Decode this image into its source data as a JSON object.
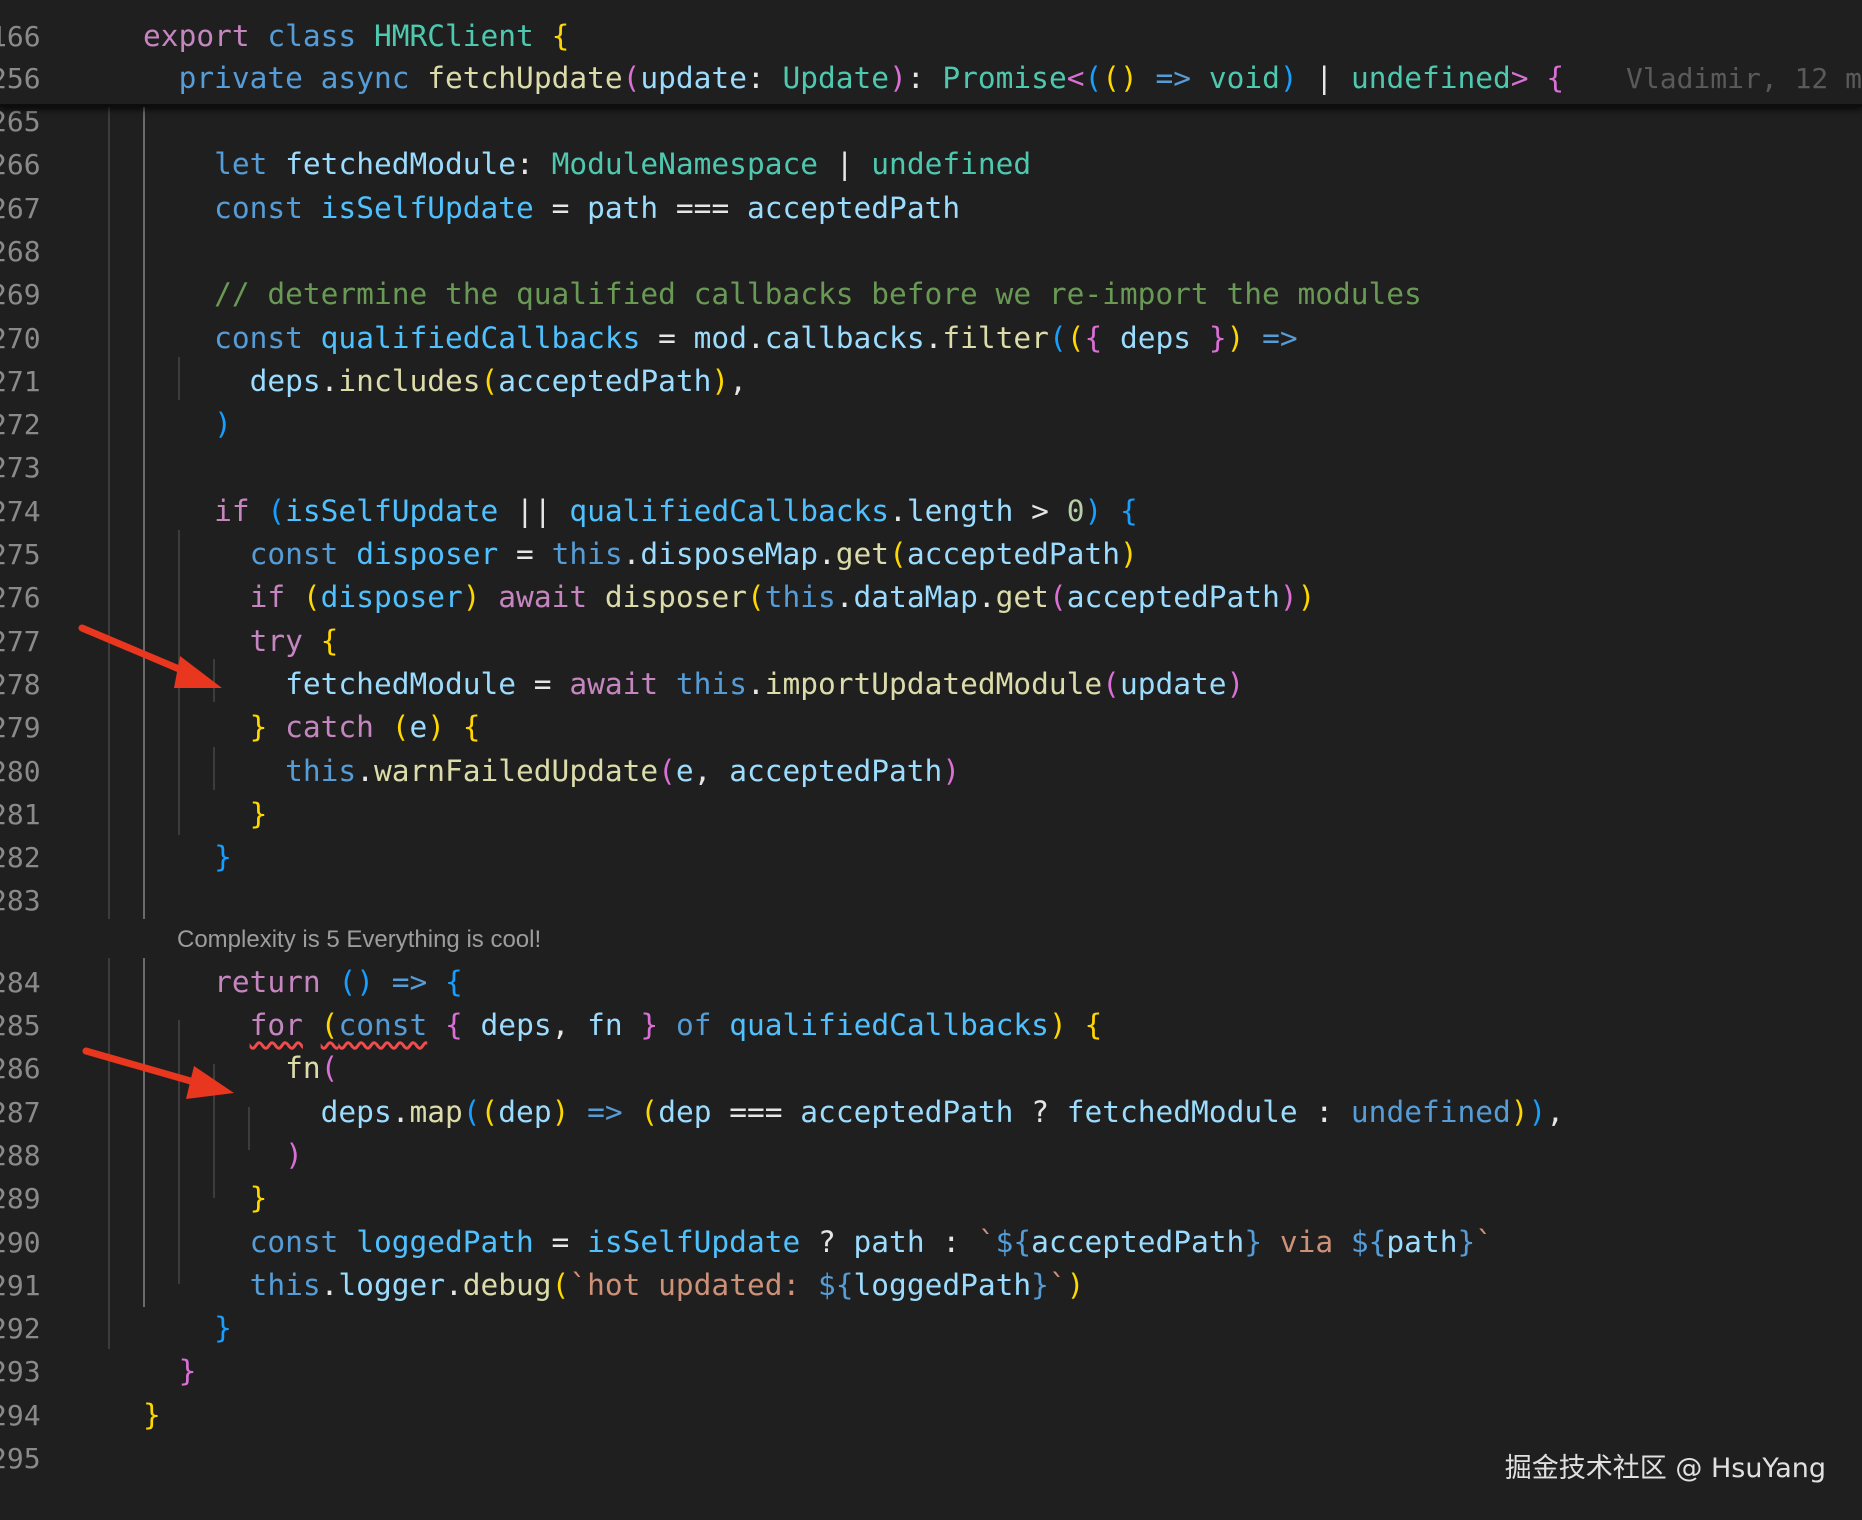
{
  "editor": {
    "sticky": [
      {
        "ln": "166",
        "tokens": [
          [
            "    ",
            ""
          ],
          [
            "export",
            "k-purple"
          ],
          [
            " ",
            ""
          ],
          [
            "class",
            "k-blue"
          ],
          [
            " ",
            ""
          ],
          [
            "HMRClient",
            "k-teal"
          ],
          [
            " ",
            ""
          ],
          [
            "{",
            "b1"
          ]
        ]
      },
      {
        "ln": "256",
        "tokens": [
          [
            "      ",
            ""
          ],
          [
            "private",
            "k-blue"
          ],
          [
            " ",
            ""
          ],
          [
            "async",
            "k-blue"
          ],
          [
            " ",
            ""
          ],
          [
            "fetchUpdate",
            "k-yellow"
          ],
          [
            "(",
            "b2"
          ],
          [
            "update",
            "k-var"
          ],
          [
            ": ",
            "k-white"
          ],
          [
            "Update",
            "k-teal"
          ],
          [
            ")",
            "b2"
          ],
          [
            ": ",
            "k-white"
          ],
          [
            "Promise",
            "k-teal"
          ],
          [
            "<",
            "b2"
          ],
          [
            "(",
            "b3"
          ],
          [
            "()",
            "b1"
          ],
          [
            " ",
            ""
          ],
          [
            "=>",
            "k-blue"
          ],
          [
            " ",
            ""
          ],
          [
            "void",
            "k-teal"
          ],
          [
            ")",
            "b3"
          ],
          [
            " | ",
            "k-white"
          ],
          [
            "undefined",
            "k-teal"
          ],
          [
            ">",
            "b2"
          ],
          [
            " ",
            ""
          ],
          [
            "{",
            "b2"
          ]
        ]
      }
    ],
    "blame": "Vladimir, 12 m",
    "lines": [
      {
        "ln": "265",
        "tokens": []
      },
      {
        "ln": "266",
        "tokens": [
          [
            "        ",
            ""
          ],
          [
            "let",
            "k-blue"
          ],
          [
            " ",
            ""
          ],
          [
            "fetchedModule",
            "k-var"
          ],
          [
            ": ",
            "k-white"
          ],
          [
            "ModuleNamespace",
            "k-teal"
          ],
          [
            " | ",
            "k-white"
          ],
          [
            "undefined",
            "k-teal"
          ]
        ]
      },
      {
        "ln": "267",
        "tokens": [
          [
            "        ",
            ""
          ],
          [
            "const",
            "k-blue"
          ],
          [
            " ",
            ""
          ],
          [
            "isSelfUpdate",
            "k-const"
          ],
          [
            " = ",
            "k-white"
          ],
          [
            "path",
            "k-var"
          ],
          [
            " === ",
            "k-white"
          ],
          [
            "acceptedPath",
            "k-var"
          ]
        ]
      },
      {
        "ln": "268",
        "tokens": []
      },
      {
        "ln": "269",
        "tokens": [
          [
            "        ",
            ""
          ],
          [
            "// determine the qualified callbacks before we re-import the modules",
            "k-comment"
          ]
        ]
      },
      {
        "ln": "270",
        "tokens": [
          [
            "        ",
            ""
          ],
          [
            "const",
            "k-blue"
          ],
          [
            " ",
            ""
          ],
          [
            "qualifiedCallbacks",
            "k-const"
          ],
          [
            " = ",
            "k-white"
          ],
          [
            "mod",
            "k-var"
          ],
          [
            ".",
            "k-white"
          ],
          [
            "callbacks",
            "k-var"
          ],
          [
            ".",
            "k-white"
          ],
          [
            "filter",
            "k-yellow"
          ],
          [
            "(",
            "b3"
          ],
          [
            "(",
            "b1"
          ],
          [
            "{",
            "b2"
          ],
          [
            " ",
            ""
          ],
          [
            "deps",
            "k-var"
          ],
          [
            " ",
            ""
          ],
          [
            "}",
            "b2"
          ],
          [
            ")",
            "b1"
          ],
          [
            " ",
            ""
          ],
          [
            "=>",
            "k-blue"
          ]
        ]
      },
      {
        "ln": "271",
        "tokens": [
          [
            "          ",
            ""
          ],
          [
            "deps",
            "k-var"
          ],
          [
            ".",
            "k-white"
          ],
          [
            "includes",
            "k-yellow"
          ],
          [
            "(",
            "b1"
          ],
          [
            "acceptedPath",
            "k-var"
          ],
          [
            ")",
            "b1"
          ],
          [
            ",",
            "k-white"
          ]
        ]
      },
      {
        "ln": "272",
        "tokens": [
          [
            "        ",
            ""
          ],
          [
            ")",
            "b3"
          ]
        ]
      },
      {
        "ln": "273",
        "tokens": []
      },
      {
        "ln": "274",
        "tokens": [
          [
            "        ",
            ""
          ],
          [
            "if",
            "k-purple"
          ],
          [
            " ",
            ""
          ],
          [
            "(",
            "b3"
          ],
          [
            "isSelfUpdate",
            "k-const"
          ],
          [
            " || ",
            "k-white"
          ],
          [
            "qualifiedCallbacks",
            "k-const"
          ],
          [
            ".",
            "k-white"
          ],
          [
            "length",
            "k-var"
          ],
          [
            " > ",
            "k-white"
          ],
          [
            "0",
            "k-num"
          ],
          [
            ")",
            "b3"
          ],
          [
            " ",
            ""
          ],
          [
            "{",
            "b3"
          ]
        ]
      },
      {
        "ln": "275",
        "tokens": [
          [
            "          ",
            ""
          ],
          [
            "const",
            "k-blue"
          ],
          [
            " ",
            ""
          ],
          [
            "disposer",
            "k-const"
          ],
          [
            " = ",
            "k-white"
          ],
          [
            "this",
            "k-blue"
          ],
          [
            ".",
            "k-white"
          ],
          [
            "disposeMap",
            "k-var"
          ],
          [
            ".",
            "k-white"
          ],
          [
            "get",
            "k-yellow"
          ],
          [
            "(",
            "b1"
          ],
          [
            "acceptedPath",
            "k-var"
          ],
          [
            ")",
            "b1"
          ]
        ]
      },
      {
        "ln": "276",
        "tokens": [
          [
            "          ",
            ""
          ],
          [
            "if",
            "k-purple"
          ],
          [
            " ",
            ""
          ],
          [
            "(",
            "b1"
          ],
          [
            "disposer",
            "k-const"
          ],
          [
            ")",
            "b1"
          ],
          [
            " ",
            ""
          ],
          [
            "await",
            "k-purple"
          ],
          [
            " ",
            ""
          ],
          [
            "disposer",
            "k-yellow"
          ],
          [
            "(",
            "b1"
          ],
          [
            "this",
            "k-blue"
          ],
          [
            ".",
            "k-white"
          ],
          [
            "dataMap",
            "k-var"
          ],
          [
            ".",
            "k-white"
          ],
          [
            "get",
            "k-yellow"
          ],
          [
            "(",
            "b2"
          ],
          [
            "acceptedPath",
            "k-var"
          ],
          [
            ")",
            "b2"
          ],
          [
            ")",
            "b1"
          ]
        ]
      },
      {
        "ln": "277",
        "tokens": [
          [
            "          ",
            ""
          ],
          [
            "try",
            "k-purple"
          ],
          [
            " ",
            ""
          ],
          [
            "{",
            "b1"
          ]
        ]
      },
      {
        "ln": "278",
        "tokens": [
          [
            "            ",
            ""
          ],
          [
            "fetchedModule",
            "k-var"
          ],
          [
            " = ",
            "k-white"
          ],
          [
            "await",
            "k-purple"
          ],
          [
            " ",
            ""
          ],
          [
            "this",
            "k-blue"
          ],
          [
            ".",
            "k-white"
          ],
          [
            "importUpdatedModule",
            "k-yellow"
          ],
          [
            "(",
            "b2"
          ],
          [
            "update",
            "k-var"
          ],
          [
            ")",
            "b2"
          ]
        ]
      },
      {
        "ln": "279",
        "tokens": [
          [
            "          ",
            ""
          ],
          [
            "}",
            "b1"
          ],
          [
            " ",
            ""
          ],
          [
            "catch",
            "k-purple"
          ],
          [
            " ",
            ""
          ],
          [
            "(",
            "b1"
          ],
          [
            "e",
            "k-var"
          ],
          [
            ")",
            "b1"
          ],
          [
            " ",
            ""
          ],
          [
            "{",
            "b1"
          ]
        ]
      },
      {
        "ln": "280",
        "tokens": [
          [
            "            ",
            ""
          ],
          [
            "this",
            "k-blue"
          ],
          [
            ".",
            "k-white"
          ],
          [
            "warnFailedUpdate",
            "k-yellow"
          ],
          [
            "(",
            "b2"
          ],
          [
            "e",
            "k-var"
          ],
          [
            ", ",
            "k-white"
          ],
          [
            "acceptedPath",
            "k-var"
          ],
          [
            ")",
            "b2"
          ]
        ]
      },
      {
        "ln": "281",
        "tokens": [
          [
            "          ",
            ""
          ],
          [
            "}",
            "b1"
          ]
        ]
      },
      {
        "ln": "282",
        "tokens": [
          [
            "        ",
            ""
          ],
          [
            "}",
            "b3"
          ]
        ]
      },
      {
        "ln": "283",
        "tokens": []
      },
      {
        "ln": "284",
        "tokens": [
          [
            "        ",
            ""
          ],
          [
            "return",
            "k-purple"
          ],
          [
            " ",
            ""
          ],
          [
            "()",
            "b3"
          ],
          [
            " ",
            ""
          ],
          [
            "=>",
            "k-blue"
          ],
          [
            " ",
            ""
          ],
          [
            "{",
            "b3"
          ]
        ]
      },
      {
        "ln": "285",
        "tokens": [
          [
            "          ",
            ""
          ],
          [
            "for",
            "k-purple squiggle"
          ],
          [
            " ",
            ""
          ],
          [
            "(",
            "b1 squiggle"
          ],
          [
            "const",
            "k-blue squiggle"
          ],
          [
            " ",
            ""
          ],
          [
            "{",
            "b2"
          ],
          [
            " ",
            ""
          ],
          [
            "deps",
            "k-var"
          ],
          [
            ", ",
            "k-white"
          ],
          [
            "fn",
            "k-var"
          ],
          [
            " ",
            ""
          ],
          [
            "}",
            "b2"
          ],
          [
            " ",
            ""
          ],
          [
            "of",
            "k-blue"
          ],
          [
            " ",
            ""
          ],
          [
            "qualifiedCallbacks",
            "k-const"
          ],
          [
            ")",
            "b1"
          ],
          [
            " ",
            ""
          ],
          [
            "{",
            "b1"
          ]
        ]
      },
      {
        "ln": "286",
        "tokens": [
          [
            "            ",
            ""
          ],
          [
            "fn",
            "k-yellow"
          ],
          [
            "(",
            "b2"
          ]
        ]
      },
      {
        "ln": "287",
        "tokens": [
          [
            "              ",
            ""
          ],
          [
            "deps",
            "k-var"
          ],
          [
            ".",
            "k-white"
          ],
          [
            "map",
            "k-yellow"
          ],
          [
            "(",
            "b3"
          ],
          [
            "(",
            "b1"
          ],
          [
            "dep",
            "k-var"
          ],
          [
            ")",
            "b1"
          ],
          [
            " ",
            ""
          ],
          [
            "=>",
            "k-blue"
          ],
          [
            " ",
            ""
          ],
          [
            "(",
            "b1"
          ],
          [
            "dep",
            "k-var"
          ],
          [
            " === ",
            "k-white"
          ],
          [
            "acceptedPath",
            "k-var"
          ],
          [
            " ? ",
            "k-white"
          ],
          [
            "fetchedModule",
            "k-var"
          ],
          [
            " : ",
            "k-white"
          ],
          [
            "undefined",
            "k-blue"
          ],
          [
            ")",
            "b1"
          ],
          [
            ")",
            "b3"
          ],
          [
            ",",
            "k-white"
          ]
        ]
      },
      {
        "ln": "288",
        "tokens": [
          [
            "            ",
            ""
          ],
          [
            ")",
            "b2"
          ]
        ]
      },
      {
        "ln": "289",
        "tokens": [
          [
            "          ",
            ""
          ],
          [
            "}",
            "b1"
          ]
        ]
      },
      {
        "ln": "290",
        "tokens": [
          [
            "          ",
            ""
          ],
          [
            "const",
            "k-blue"
          ],
          [
            " ",
            ""
          ],
          [
            "loggedPath",
            "k-const"
          ],
          [
            " = ",
            "k-white"
          ],
          [
            "isSelfUpdate",
            "k-const"
          ],
          [
            " ? ",
            "k-white"
          ],
          [
            "path",
            "k-var"
          ],
          [
            " : ",
            "k-white"
          ],
          [
            "`",
            "k-str"
          ],
          [
            "${",
            "k-blue"
          ],
          [
            "acceptedPath",
            "k-var"
          ],
          [
            "}",
            "k-blue"
          ],
          [
            " via ",
            "k-str"
          ],
          [
            "${",
            "k-blue"
          ],
          [
            "path",
            "k-var"
          ],
          [
            "}",
            "k-blue"
          ],
          [
            "`",
            "k-str"
          ]
        ]
      },
      {
        "ln": "291",
        "tokens": [
          [
            "          ",
            ""
          ],
          [
            "this",
            "k-blue"
          ],
          [
            ".",
            "k-white"
          ],
          [
            "logger",
            "k-var"
          ],
          [
            ".",
            "k-white"
          ],
          [
            "debug",
            "k-yellow"
          ],
          [
            "(",
            "b1"
          ],
          [
            "`hot updated: ",
            "k-str"
          ],
          [
            "${",
            "k-blue"
          ],
          [
            "loggedPath",
            "k-var"
          ],
          [
            "}",
            "k-blue"
          ],
          [
            "`",
            "k-str"
          ],
          [
            ")",
            "b1"
          ]
        ]
      },
      {
        "ln": "292",
        "tokens": [
          [
            "        ",
            ""
          ],
          [
            "}",
            "b3"
          ]
        ]
      },
      {
        "ln": "293",
        "tokens": [
          [
            "      ",
            ""
          ],
          [
            "}",
            "b2"
          ]
        ]
      },
      {
        "ln": "294",
        "tokens": [
          [
            "    ",
            ""
          ],
          [
            "}",
            "b1"
          ]
        ]
      },
      {
        "ln": "295",
        "tokens": []
      }
    ],
    "codelens": "Complexity is 5 Everything is cool!"
  },
  "watermark": "掘金技术社区 @ HsuYang",
  "colors": {
    "background": "#1f1f1f",
    "arrow": "#e8361f"
  }
}
